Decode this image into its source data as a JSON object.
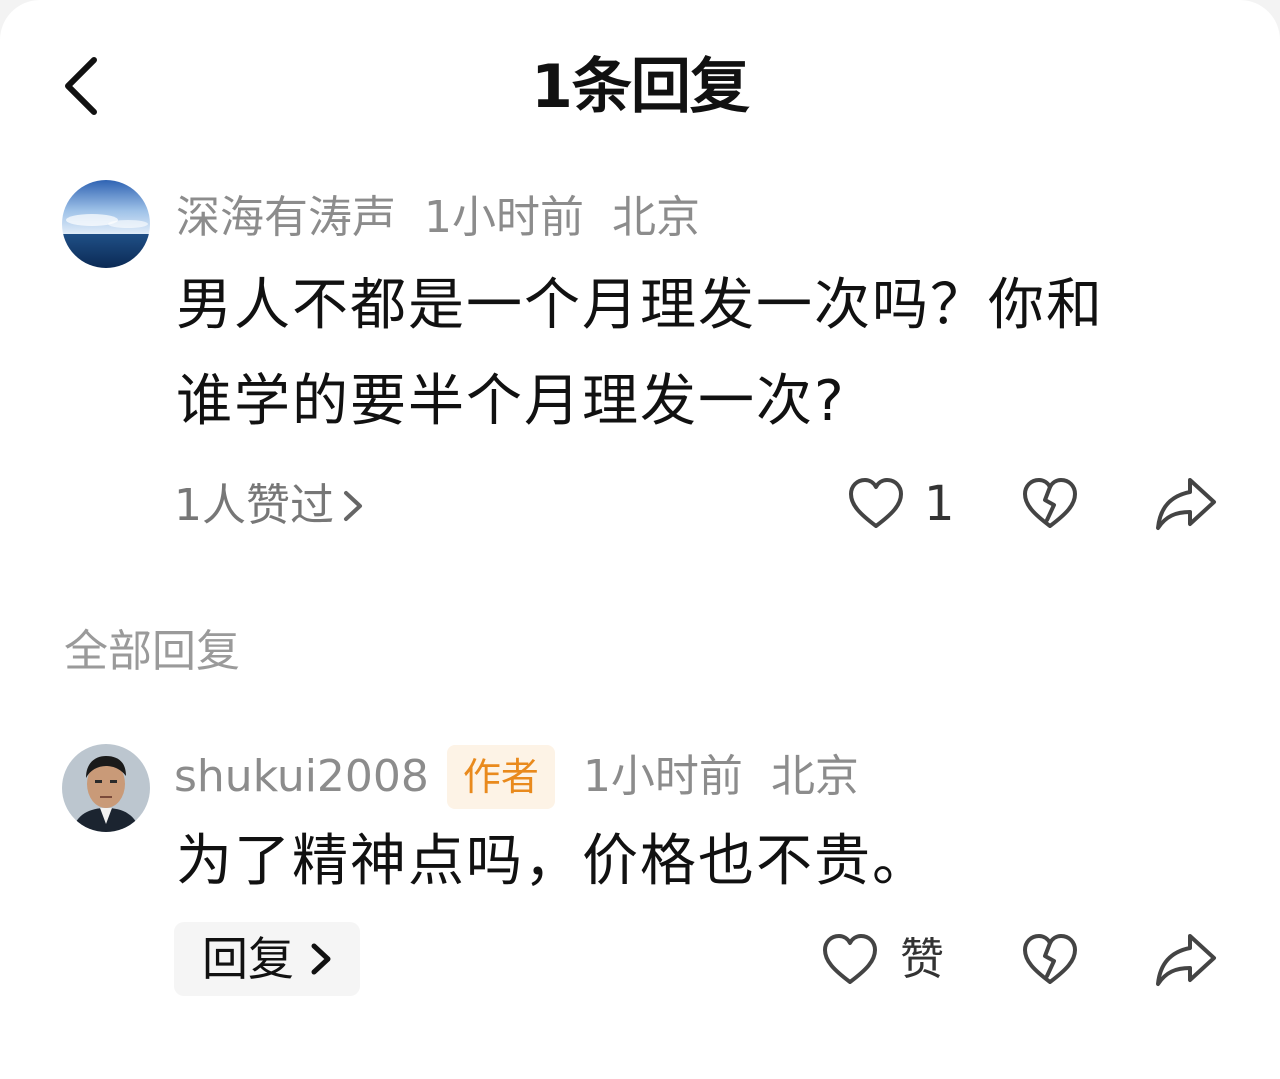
{
  "header": {
    "title": "1条回复"
  },
  "main_comment": {
    "username": "深海有涛声",
    "time": "1小时前",
    "location": "北京",
    "content_line1": "男人不都是一个月理发一次吗？你和",
    "content_line2": "谁学的要半个月理发一次?",
    "likes_summary": "1人赞过",
    "like_count": "1"
  },
  "section": {
    "label": "全部回复"
  },
  "reply": {
    "username": "shukui2008",
    "badge": "作者",
    "time": "1小时前",
    "location": "北京",
    "content": "为了精神点吗，价格也不贵。",
    "reply_button": "回复",
    "like_label": "赞"
  },
  "colors": {
    "badge_bg": "#fdf3e6",
    "badge_text": "#e98a1d",
    "meta": "#8c8c8c"
  },
  "icons": [
    "back-arrow-icon",
    "heart-icon",
    "broken-heart-icon",
    "share-icon",
    "chevron-right-icon"
  ]
}
